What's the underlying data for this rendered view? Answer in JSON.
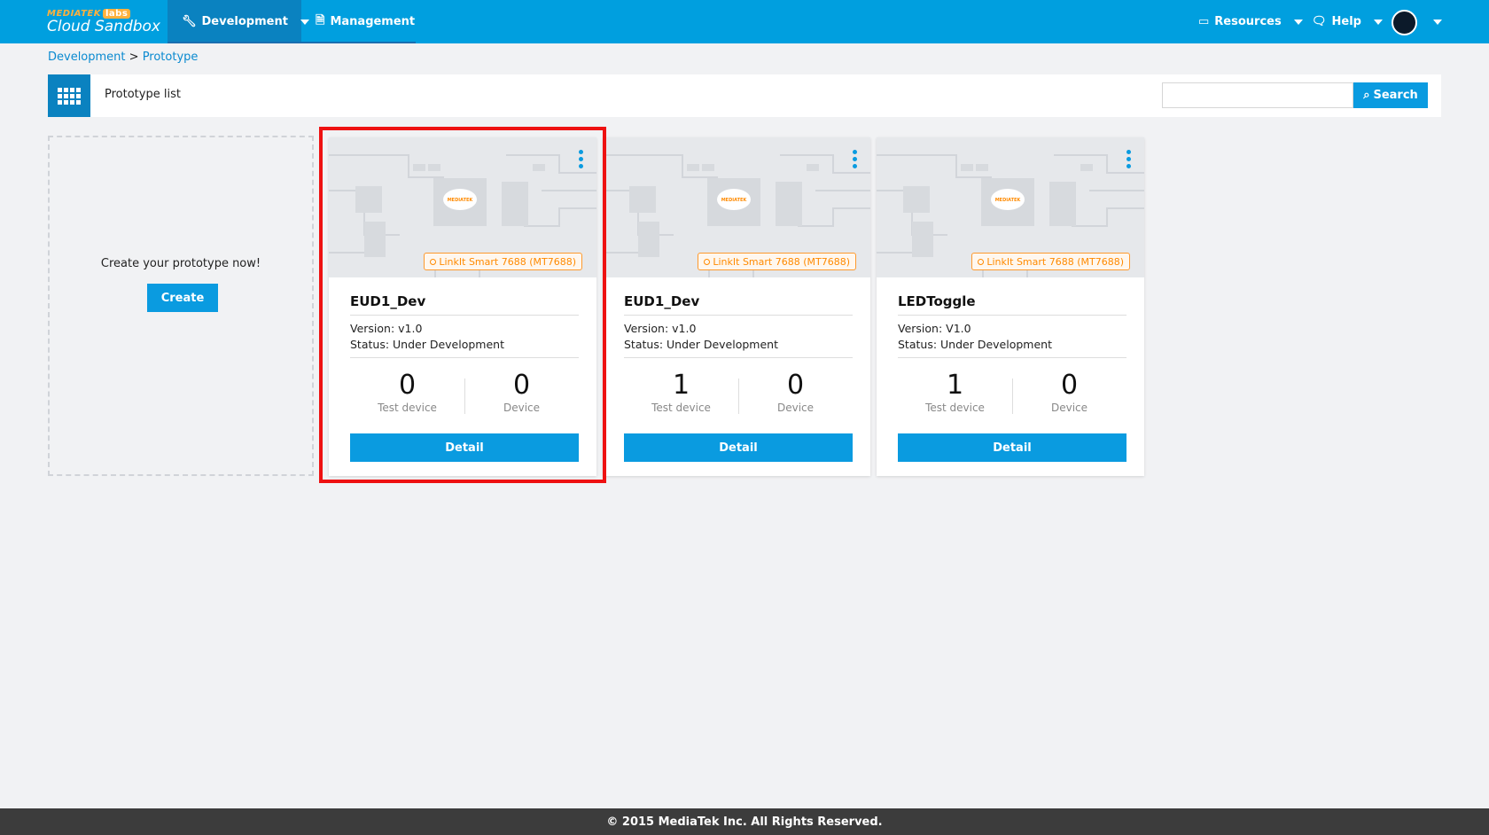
{
  "brand": {
    "small": "MEDIATEK",
    "labs": "labs",
    "name": "Cloud Sandbox"
  },
  "nav": {
    "development": "Development",
    "management": "Management",
    "resources": "Resources",
    "help": "Help"
  },
  "breadcrumb": {
    "first": "Development",
    "separator": " > ",
    "second": "Prototype"
  },
  "list": {
    "title": "Prototype list"
  },
  "search": {
    "placeholder": "",
    "button": "Search"
  },
  "create": {
    "text": "Create your prototype now!",
    "button": "Create"
  },
  "cards": [
    {
      "board": "LinkIt Smart 7688 (MT7688)",
      "name": "EUD1_Dev",
      "version": "Version: v1.0",
      "status": "Status: Under Development",
      "test_devices": "0",
      "test_label": "Test device",
      "devices": "0",
      "device_label": "Device",
      "button": "Detail"
    },
    {
      "board": "LinkIt Smart 7688 (MT7688)",
      "name": "EUD1_Dev",
      "version": "Version: v1.0",
      "status": "Status: Under Development",
      "test_devices": "1",
      "test_label": "Test device",
      "devices": "0",
      "device_label": "Device",
      "button": "Detail"
    },
    {
      "board": "LinkIt Smart 7688 (MT7688)",
      "name": "LEDToggle",
      "version": "Version: V1.0",
      "status": "Status: Under Development",
      "test_devices": "1",
      "test_label": "Test device",
      "devices": "0",
      "device_label": "Device",
      "button": "Detail"
    }
  ],
  "footer": {
    "text": "© 2015 MediaTek Inc. All Rights Reserved."
  },
  "colors": {
    "primary": "#009fdf",
    "accent": "#0a9be0",
    "tag": "#ff8a00",
    "highlight": "#ee1111"
  }
}
